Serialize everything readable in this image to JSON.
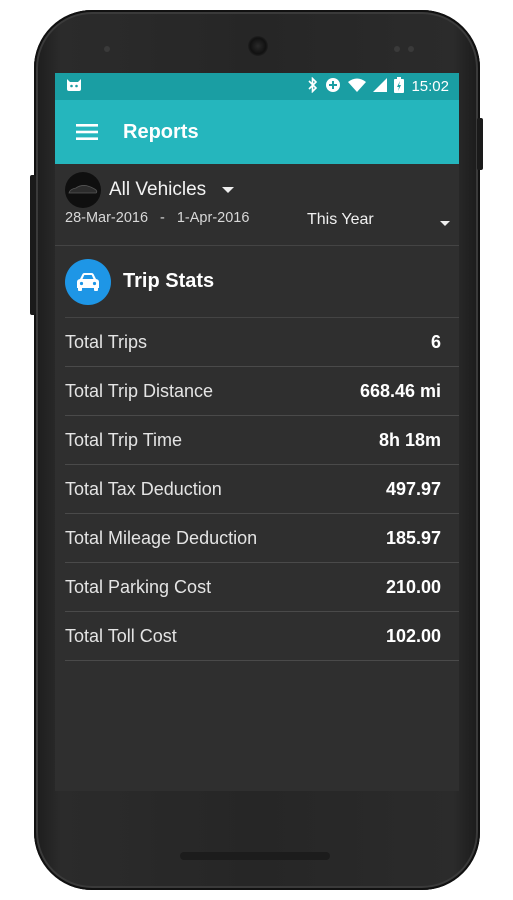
{
  "status_bar": {
    "time": "15:02",
    "icons": [
      "android-cat-icon",
      "bluetooth-icon",
      "sync-icon",
      "wifi-icon",
      "signal-icon",
      "battery-charging-icon"
    ]
  },
  "app_bar": {
    "menu_icon": "hamburger-menu-icon",
    "title": "Reports"
  },
  "filter": {
    "vehicle": "All Vehicles",
    "date_from": "28-Mar-2016",
    "date_separator": "-",
    "date_to": "1-Apr-2016",
    "period": "This Year"
  },
  "stats": {
    "title": "Trip Stats",
    "rows": [
      {
        "label": "Total Trips",
        "value": "6"
      },
      {
        "label": "Total Trip Distance",
        "value": "668.46 mi"
      },
      {
        "label": "Total Trip Time",
        "value": "8h 18m"
      },
      {
        "label": "Total Tax Deduction",
        "value": "497.97"
      },
      {
        "label": "Total Mileage Deduction",
        "value": "185.97"
      },
      {
        "label": "Total Parking Cost",
        "value": "210.00"
      },
      {
        "label": "Total Toll Cost",
        "value": "102.00"
      }
    ]
  },
  "colors": {
    "status_bar": "#1a9ea3",
    "app_bar": "#25b6bd",
    "screen_background": "#2f2f2f",
    "stats_icon": "#1e96e6"
  }
}
